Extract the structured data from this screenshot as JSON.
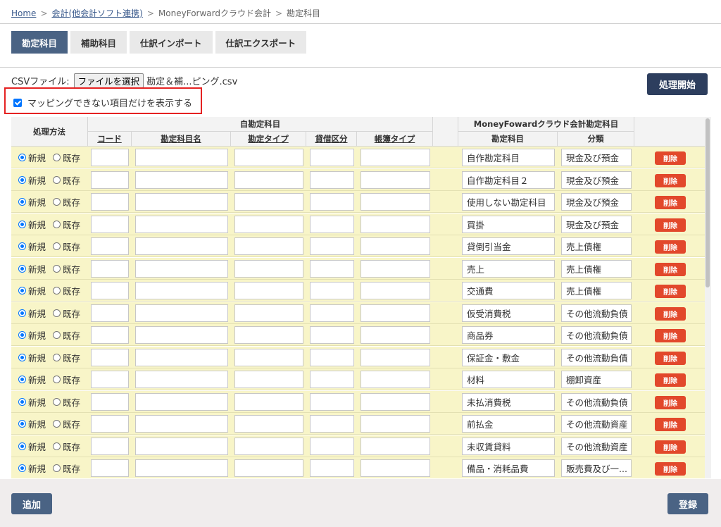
{
  "breadcrumb": {
    "home": "Home",
    "accounting": "会計(他会計ソフト連携)",
    "moneyforward": "MoneyForwardクラウド会計",
    "current": "勘定科目",
    "separator": ">"
  },
  "tabs": [
    {
      "label": "勘定科目",
      "active": true
    },
    {
      "label": "補助科目",
      "active": false
    },
    {
      "label": "仕訳インポート",
      "active": false
    },
    {
      "label": "仕訳エクスポート",
      "active": false
    }
  ],
  "csv": {
    "label": "CSVファイル:",
    "button": "ファイルを選択",
    "filename": "勘定＆補...ピング.csv"
  },
  "start_button": "処理開始",
  "filter_checkbox": {
    "label": "マッピングできない項目だけを表示する",
    "checked": true
  },
  "table": {
    "header": {
      "method": "処理方法",
      "own_group": "自勘定科目",
      "code": "コード",
      "account_name": "勘定科目名",
      "account_type": "勘定タイプ",
      "debit_credit": "貸借区分",
      "book_type": "帳簿タイプ",
      "mf_group": "MoneyFowardクラウド会計勘定科目",
      "mf_account": "勘定科目",
      "mf_category": "分類"
    },
    "radio_new": "新規",
    "radio_existing": "既存",
    "delete_label": "削除",
    "rows": [
      {
        "account": "自作勘定科目",
        "category": "現金及び預金"
      },
      {
        "account": "自作勘定科目２",
        "category": "現金及び預金"
      },
      {
        "account": "使用しない勘定科目",
        "category": "現金及び預金"
      },
      {
        "account": "買掛",
        "category": "現金及び預金"
      },
      {
        "account": "貸倒引当金",
        "category": "売上債権"
      },
      {
        "account": "売上",
        "category": "売上債権"
      },
      {
        "account": "交通費",
        "category": "売上債権"
      },
      {
        "account": "仮受消費税",
        "category": "その他流動負債"
      },
      {
        "account": "商品券",
        "category": "その他流動負債"
      },
      {
        "account": "保証金・敷金",
        "category": "その他流動負債"
      },
      {
        "account": "材料",
        "category": "棚卸資産"
      },
      {
        "account": "未払消費税",
        "category": "その他流動負債"
      },
      {
        "account": "前払金",
        "category": "その他流動資産"
      },
      {
        "account": "未収賃貸料",
        "category": "その他流動資産"
      },
      {
        "account": "備品・消耗品費",
        "category": "販売費及び一..."
      }
    ]
  },
  "footer": {
    "add_button": "追加",
    "register_button": "登録"
  },
  "colors": {
    "primary": "#4a6384",
    "dark": "#2d3e5e",
    "danger": "#e2482b",
    "row_bg": "#f8f5c8",
    "highlight_border": "#e52222"
  }
}
